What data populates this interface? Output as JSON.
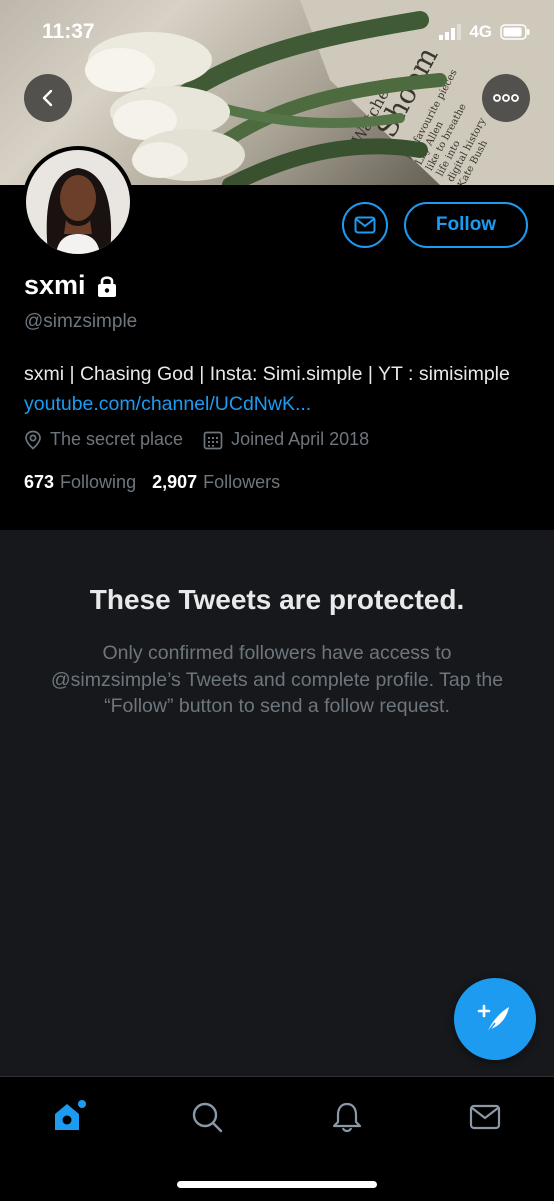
{
  "status_bar": {
    "time": "11:37",
    "network": "4G"
  },
  "banner": {
    "newspaper_words": [
      "Watches",
      "Shoem",
      "My favourite pieces",
      "Lily Allen",
      "like to breathe",
      "life into",
      "digital history",
      "Kate Bush"
    ]
  },
  "profile": {
    "name": "sxmi",
    "handle": "@simzsimple",
    "bio_text": "sxmi | Chasing God | Insta: Simi.simple | YT : simisimple ",
    "bio_link": "youtube.com/channel/UCdNwK...",
    "location": "The secret place",
    "joined": "Joined April 2018",
    "following_count": "673",
    "following_label": "Following",
    "followers_count": "2,907",
    "followers_label": "Followers"
  },
  "actions": {
    "follow_label": "Follow"
  },
  "protected": {
    "title": "These Tweets are protected.",
    "body": "Only confirmed followers have access to @simzsimple’s Tweets and complete profile. Tap the “Follow” button to send a follow request."
  },
  "tabs": [
    "home-icon",
    "search-icon",
    "bell-icon",
    "mail-icon"
  ],
  "colors": {
    "accent": "#1d9bf0",
    "background": "#000000",
    "panel": "#16181c",
    "muted": "#6e767d"
  }
}
